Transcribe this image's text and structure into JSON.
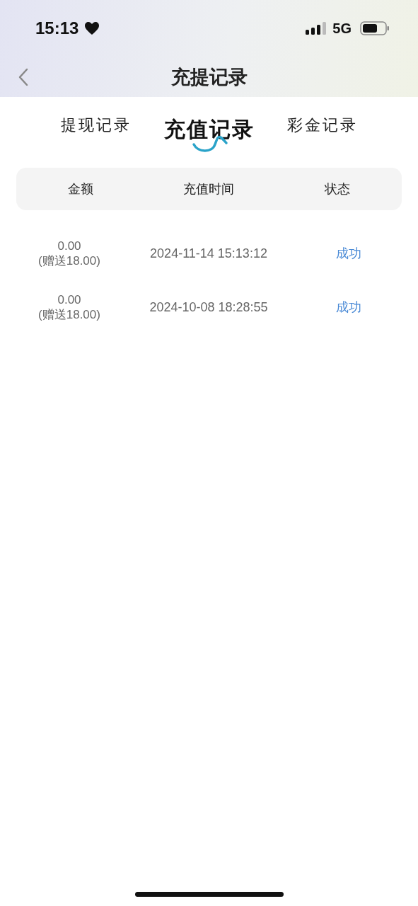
{
  "status_bar": {
    "time": "15:13",
    "network": "5G"
  },
  "header": {
    "title": "充提记录"
  },
  "tabs": [
    {
      "label": "提现记录",
      "selected": false
    },
    {
      "label": "充值记录",
      "selected": true
    },
    {
      "label": "彩金记录",
      "selected": false
    }
  ],
  "table": {
    "columns": [
      "金额",
      "充值时间",
      "状态"
    ],
    "rows": [
      {
        "amount": "0.00",
        "bonus": "(赠送18.00)",
        "time": "2024-11-14 15:13:12",
        "status": "成功"
      },
      {
        "amount": "0.00",
        "bonus": "(赠送18.00)",
        "time": "2024-10-08 18:28:55",
        "status": "成功"
      }
    ]
  }
}
